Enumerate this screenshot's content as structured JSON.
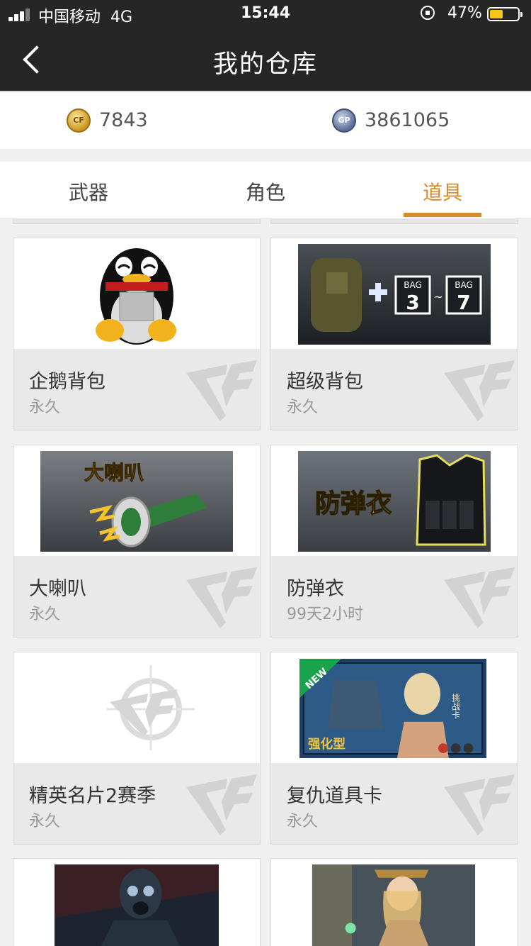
{
  "status": {
    "carrier": "中国移动",
    "network": "4G",
    "time": "15:44",
    "battery": "47%",
    "battery_level": 0.47
  },
  "nav": {
    "title": "我的仓库",
    "back_icon": "chevron-left-icon"
  },
  "currency": {
    "cf_points": "7843",
    "gp": "3861065",
    "gp_label": "GP"
  },
  "tabs": [
    {
      "label": "武器",
      "active": false
    },
    {
      "label": "角色",
      "active": false
    },
    {
      "label": "道具",
      "active": true
    }
  ],
  "accent_color": "#d98a2b",
  "items": [
    {
      "name": "企鹅背包",
      "duration": "永久",
      "image": "penguin-backpack"
    },
    {
      "name": "超级背包",
      "duration": "永久",
      "image": "super-backpack",
      "badges": [
        "BAG",
        "3",
        "BAG",
        "7"
      ]
    },
    {
      "name": "大喇叭",
      "duration": "永久",
      "image": "megaphone",
      "caption": "大喇叭"
    },
    {
      "name": "防弹衣",
      "duration": "99天2小时",
      "image": "bulletproof-vest",
      "caption": "防弹衣"
    },
    {
      "name": "精英名片2赛季",
      "duration": "永久",
      "image": "cf-logo-placeholder"
    },
    {
      "name": "复仇道具卡",
      "duration": "永久",
      "image": "revenge-card",
      "badges": [
        "NEW",
        "强化型",
        "挑战卡"
      ]
    },
    {
      "name": "",
      "duration": "",
      "image": "gas-mask-soldier"
    },
    {
      "name": "",
      "duration": "",
      "image": "female-officer"
    }
  ]
}
